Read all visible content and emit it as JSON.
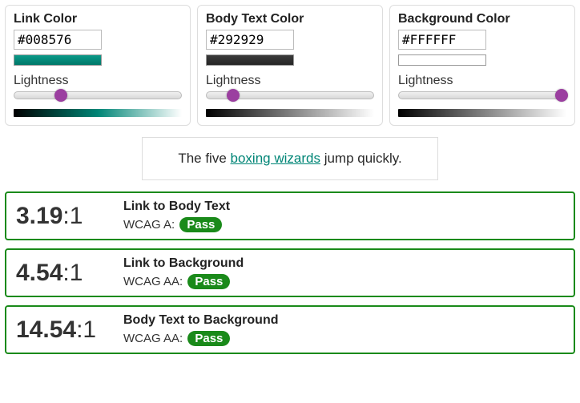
{
  "panels": [
    {
      "title": "Link Color",
      "hex": "#008576",
      "lightness_label": "Lightness",
      "thumb_pct": 28
    },
    {
      "title": "Body Text Color",
      "hex": "#292929",
      "lightness_label": "Lightness",
      "thumb_pct": 16
    },
    {
      "title": "Background Color",
      "hex": "#FFFFFF",
      "lightness_label": "Lightness",
      "thumb_pct": 97
    }
  ],
  "sample": {
    "before": "The five ",
    "link": "boxing wizards",
    "after": " jump quickly."
  },
  "colors": {
    "link": "#008576",
    "body": "#292929",
    "background": "#FFFFFF",
    "slider_thumb": "#9b3fa0",
    "pass_green": "#1a8a1a"
  },
  "results": [
    {
      "ratio": "3.19",
      "suffix": ":1",
      "title": "Link to Body Text",
      "level_prefix": "WCAG A: ",
      "badge": "Pass"
    },
    {
      "ratio": "4.54",
      "suffix": ":1",
      "title": "Link to Background",
      "level_prefix": "WCAG AA: ",
      "badge": "Pass"
    },
    {
      "ratio": "14.54",
      "suffix": ":1",
      "title": "Body Text to Background",
      "level_prefix": "WCAG AA: ",
      "badge": "Pass"
    }
  ]
}
